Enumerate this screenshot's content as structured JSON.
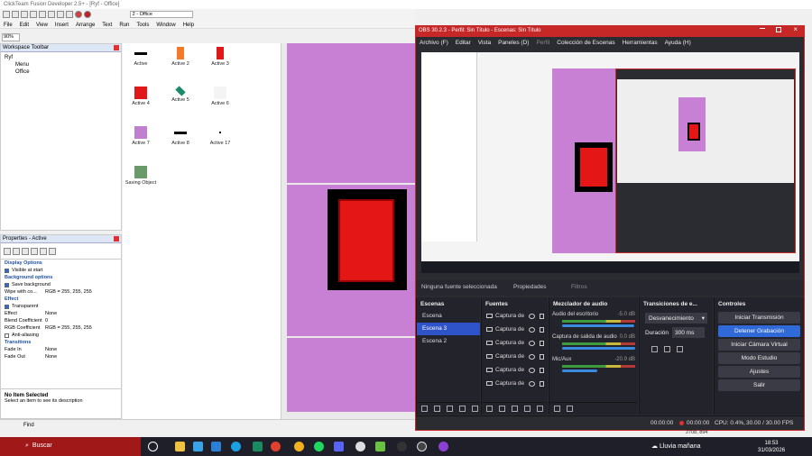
{
  "cf": {
    "title": "Click​Team Fusion Developer 2.5+ - [Ryf - Office]",
    "frame_select": "2 - Office",
    "zoom": "90%",
    "menu": [
      "File",
      "Edit",
      "View",
      "Insert",
      "Arrange",
      "Text",
      "Run",
      "Tools",
      "Window",
      "Help"
    ],
    "workspace": {
      "title": "Workspace Toolbar",
      "tree": [
        "Ryf",
        "Menu",
        "Office"
      ]
    },
    "objects": [
      {
        "label": "Active",
        "color": "#000000",
        "shape": "bar"
      },
      {
        "label": "Active 2",
        "color": "#f07a28",
        "shape": "tall"
      },
      {
        "label": "Active 3",
        "color": "#e01818",
        "shape": "tall"
      },
      {
        "label": "Active 4",
        "color": "#e01818",
        "shape": "square"
      },
      {
        "label": "Active 5",
        "color": "#1a8a6a",
        "shape": "diamond"
      },
      {
        "label": "Active 6",
        "color": "#f4f4f4",
        "shape": "square"
      },
      {
        "label": "Active 7",
        "color": "#c080d0",
        "shape": "square"
      },
      {
        "label": "Active 8",
        "color": "#000000",
        "shape": "bar"
      },
      {
        "label": "Active 17",
        "color": "#000000",
        "shape": "dot"
      },
      {
        "label": "Saving Object",
        "color": "#6a9a6a",
        "shape": "square"
      }
    ],
    "properties": {
      "title": "Properties - Active",
      "rows": [
        {
          "type": "cat",
          "text": "Display Options"
        },
        {
          "type": "chk",
          "text": "Visible at start",
          "on": true
        },
        {
          "type": "cat",
          "text": "Background options"
        },
        {
          "type": "chk",
          "text": "Save background",
          "on": true
        },
        {
          "type": "kv",
          "key": "Wipe with co...",
          "value": "RGB = 255, 255, 255"
        },
        {
          "type": "cat",
          "text": "Effect"
        },
        {
          "type": "chk",
          "text": "Transparent",
          "on": true
        },
        {
          "type": "kv",
          "key": "Effect",
          "value": "None"
        },
        {
          "type": "kv",
          "key": "Blend Coefficient",
          "value": "0"
        },
        {
          "type": "kv",
          "key": "RGB Coefficient",
          "value": "RGB = 255, 255, 255"
        },
        {
          "type": "chk",
          "text": "Anti-aliasing",
          "on": false
        },
        {
          "type": "cat",
          "text": "Transitions"
        },
        {
          "type": "kv",
          "key": "Fade In",
          "value": "None"
        },
        {
          "type": "kv",
          "key": "Fade Out",
          "value": "None"
        }
      ],
      "desc_title": "No Item Selected",
      "desc_text": "Select an item to see its description"
    },
    "find_label": "Find"
  },
  "obs": {
    "title": "OBS 30.2.3 - Perfil: Sin Título - Escenas: Sin Título",
    "menu": [
      "Archivo (F)",
      "Editar",
      "Vista",
      "Paneles (D)",
      "Perfil",
      "Colección de Escenas",
      "Herramientas",
      "Ayuda (H)"
    ],
    "source_bar": {
      "none_selected": "Ninguna fuente seleccionada",
      "properties": "Propiedades",
      "filters": "Filtros"
    },
    "scenes": {
      "title": "Escenas",
      "items": [
        "Escena",
        "Escena 3",
        "Escena 2"
      ],
      "active_index": 1
    },
    "sources": {
      "title": "Fuentes",
      "items": [
        "Captura de",
        "Captura de",
        "Captura de",
        "Captura de",
        "Captura de",
        "Captura de"
      ]
    },
    "mixer": {
      "title": "Mezclador de audio",
      "channels": [
        {
          "name": "Audio del escritorio",
          "db": "-5.0 dB",
          "level": 0.82
        },
        {
          "name": "Captura de salida de audio",
          "db": "0.0 dB",
          "level": 0.95
        },
        {
          "name": "Mic/Aux",
          "db": "-20.9 dB",
          "level": 0.4
        }
      ]
    },
    "transitions": {
      "title": "Transiciones de e...",
      "type": "Desvanecimiento",
      "duration_label": "Duración",
      "duration": "300 ms"
    },
    "controls": {
      "title": "Controles",
      "buttons": [
        "Iniciar Transmisión",
        "Detener Grabación",
        "Iniciar Cámara Virtual",
        "Modo Estudio",
        "Ajustes",
        "Salir"
      ],
      "primary_index": 1
    },
    "status": {
      "stream_time": "00:00:00",
      "rec_time": "00:00:00",
      "cpu": "CPU: 0.4%,",
      "fps": "30.00 / 30.00 FPS"
    }
  },
  "taskbar": {
    "search": "Buscar",
    "weather": "Lluvia mañana",
    "time": "18:53",
    "date": "31/03/2026",
    "coords": "2708, 894"
  }
}
